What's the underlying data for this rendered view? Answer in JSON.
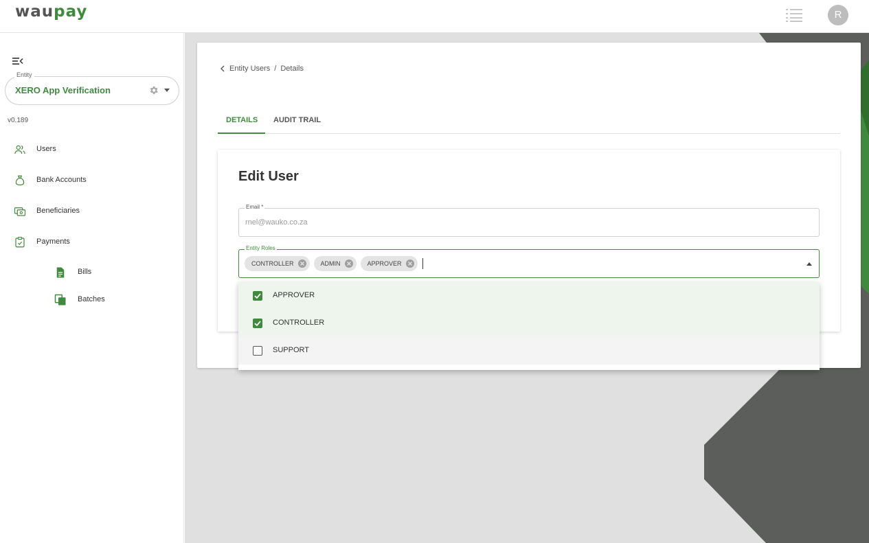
{
  "app": {
    "logo_part1": "wau",
    "logo_part2": "pay",
    "avatar_initial": "R"
  },
  "sidebar": {
    "entity_label": "Entity",
    "entity_name": "XERO App Verification",
    "version": "v0.189",
    "items": [
      {
        "label": "Users",
        "icon": "users-icon"
      },
      {
        "label": "Bank Accounts",
        "icon": "bank-bag-icon"
      },
      {
        "label": "Beneficiaries",
        "icon": "beneficiaries-icon"
      },
      {
        "label": "Payments",
        "icon": "payments-icon"
      }
    ],
    "sub_items": [
      {
        "label": "Bills",
        "icon": "document-icon"
      },
      {
        "label": "Batches",
        "icon": "copy-icon"
      }
    ]
  },
  "breadcrumb": {
    "parent": "Entity Users",
    "separator": "/",
    "current": "Details"
  },
  "tabs": [
    {
      "label": "DETAILS",
      "active": true
    },
    {
      "label": "AUDIT TRAIL",
      "active": false
    }
  ],
  "form": {
    "title": "Edit User",
    "email_label": "Email *",
    "email_value": "rnel@wauko.co.za",
    "roles_label": "Entity Roles",
    "selected_roles": [
      "CONTROLLER",
      "ADMIN",
      "APPROVER"
    ]
  },
  "dropdown": {
    "options": [
      {
        "label": "APPROVER",
        "checked": true
      },
      {
        "label": "CONTROLLER",
        "checked": true
      },
      {
        "label": "SUPPORT",
        "checked": false
      }
    ]
  },
  "colors": {
    "brand_green": "#3f8a3c",
    "deco_dark": "#5b5e5b",
    "background": "#e0e0e0"
  }
}
